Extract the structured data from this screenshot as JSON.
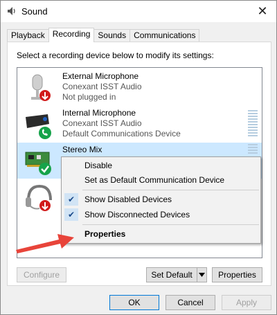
{
  "window": {
    "title": "Sound",
    "close_symbol": "✕",
    "icon": "speaker-icon"
  },
  "tabs": [
    {
      "label": "Playback",
      "active": false
    },
    {
      "label": "Recording",
      "active": true
    },
    {
      "label": "Sounds",
      "active": false
    },
    {
      "label": "Communications",
      "active": false
    }
  ],
  "recording": {
    "instruction": "Select a recording device below to modify its settings:",
    "devices": [
      {
        "name": "External Microphone",
        "driver": "Conexant ISST Audio",
        "status": "Not plugged in",
        "icon": "microphone-icon",
        "badge": "down-arrow-badge"
      },
      {
        "name": "Internal Microphone",
        "driver": "Conexant ISST Audio",
        "status": "Default Communications Device",
        "icon": "webcam-microphone-icon",
        "badge": "phone-badge"
      },
      {
        "name": "Stereo Mix",
        "driver": "",
        "status": "",
        "icon": "sound-card-icon",
        "badge": "check-badge",
        "selected": true
      },
      {
        "name": "",
        "driver": "",
        "status": "",
        "icon": "headset-icon",
        "badge": "down-arrow-badge"
      }
    ]
  },
  "context_menu": {
    "items": [
      {
        "label": "Disable",
        "checked": false
      },
      {
        "label": "Set as Default Communication Device",
        "checked": false
      },
      {
        "label": "Show Disabled Devices",
        "checked": true
      },
      {
        "label": "Show Disconnected Devices",
        "checked": true
      },
      {
        "label": "Properties",
        "checked": false,
        "bold": true
      }
    ],
    "check_symbol": "✔"
  },
  "panel_buttons": {
    "configure": "Configure",
    "set_default": "Set Default",
    "properties": "Properties"
  },
  "dialog_buttons": {
    "ok": "OK",
    "cancel": "Cancel",
    "apply": "Apply"
  },
  "colors": {
    "selection": "#cce8ff",
    "arrow": "#e8443a",
    "badge_green": "#16a34a",
    "badge_red": "#d11c1c"
  }
}
